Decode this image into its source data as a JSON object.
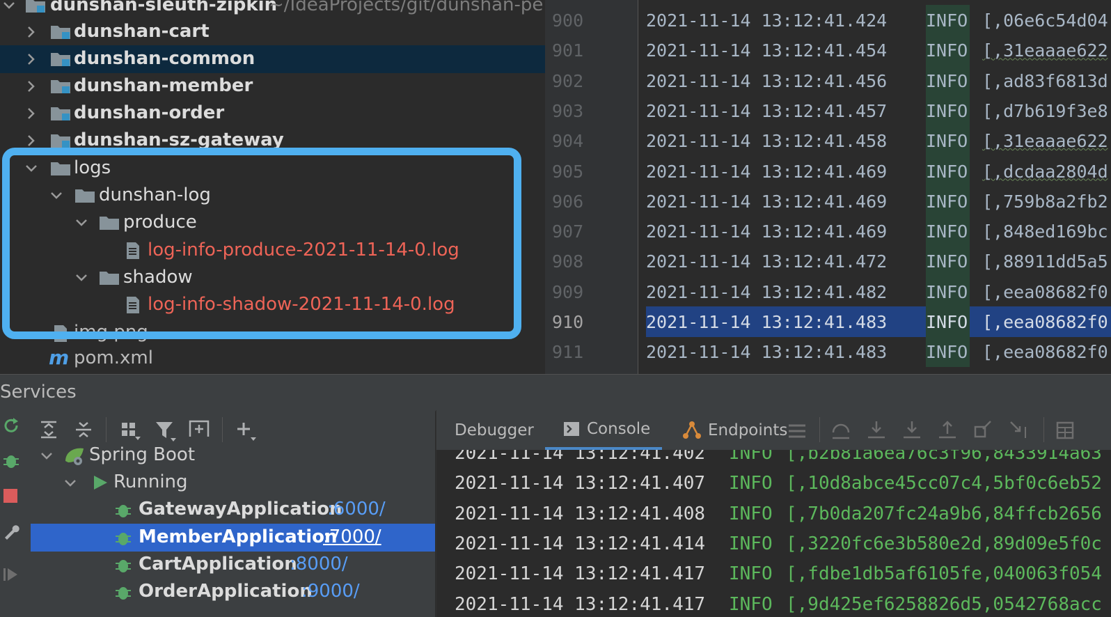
{
  "project_tree": {
    "root": {
      "name": "dunshan-sleuth-zipkin",
      "path": "~/IdeaProjects/git/dunshan-pe"
    },
    "modules": [
      "dunshan-cart",
      "dunshan-common",
      "dunshan-member",
      "dunshan-order",
      "dunshan-sz-gateway"
    ],
    "logs_folder": "logs",
    "log_subfolder": "dunshan-log",
    "produce_folder": "produce",
    "produce_file": "log-info-produce-2021-11-14-0.log",
    "shadow_folder": "shadow",
    "shadow_file": "log-info-shadow-2021-11-14-0.log",
    "img_file": "img.png",
    "pom_file": "pom.xml"
  },
  "editor": {
    "lines": [
      {
        "num": "900",
        "ts": "2021-11-14 13:12:41.424",
        "level": "INFO",
        "ctx": "[,06e6c54d04"
      },
      {
        "num": "901",
        "ts": "2021-11-14 13:12:41.454",
        "level": "INFO",
        "ctx": "[,31eaaae622"
      },
      {
        "num": "902",
        "ts": "2021-11-14 13:12:41.456",
        "level": "INFO",
        "ctx": "[,ad83f6813d"
      },
      {
        "num": "903",
        "ts": "2021-11-14 13:12:41.457",
        "level": "INFO",
        "ctx": "[,d7b619f3e8"
      },
      {
        "num": "904",
        "ts": "2021-11-14 13:12:41.458",
        "level": "INFO",
        "ctx": "[,31eaaae622"
      },
      {
        "num": "905",
        "ts": "2021-11-14 13:12:41.469",
        "level": "INFO",
        "ctx": "[,dcdaa2804d"
      },
      {
        "num": "906",
        "ts": "2021-11-14 13:12:41.469",
        "level": "INFO",
        "ctx": "[,759b8a2fb2"
      },
      {
        "num": "907",
        "ts": "2021-11-14 13:12:41.469",
        "level": "INFO",
        "ctx": "[,848ed169bc"
      },
      {
        "num": "908",
        "ts": "2021-11-14 13:12:41.472",
        "level": "INFO",
        "ctx": "[,88911dd5a5"
      },
      {
        "num": "909",
        "ts": "2021-11-14 13:12:41.482",
        "level": "INFO",
        "ctx": "[,eea08682f0"
      },
      {
        "num": "910",
        "ts": "2021-11-14 13:12:41.483",
        "level": "INFO",
        "ctx": "[,eea08682f0"
      },
      {
        "num": "911",
        "ts": "2021-11-14 13:12:41.483",
        "level": "INFO",
        "ctx": "[,eea08682f0"
      }
    ]
  },
  "services": {
    "title": "Services",
    "tree": {
      "spring_boot": "Spring Boot",
      "running": "Running",
      "apps": [
        {
          "name": "GatewayApplication",
          "port": ":6000/"
        },
        {
          "name": "MemberApplication",
          "port": ":7000/"
        },
        {
          "name": "CartApplication",
          "port": ":8000/"
        },
        {
          "name": "OrderApplication",
          "port": ":9000/"
        }
      ]
    },
    "tabs": {
      "debugger": "Debugger",
      "console": "Console",
      "endpoints": "Endpoints"
    },
    "console_lines": [
      {
        "ts": "2021-11-14 13:12:41.402",
        "level": "INFO",
        "ctx": "[,b2b81a6ea76c3f96,8433914a63"
      },
      {
        "ts": "2021-11-14 13:12:41.407",
        "level": "INFO",
        "ctx": "[,10d8abce45cc07c4,5bf0c6eb52"
      },
      {
        "ts": "2021-11-14 13:12:41.408",
        "level": "INFO",
        "ctx": "[,7b0da207fc24a9b6,84ffcb2656"
      },
      {
        "ts": "2021-11-14 13:12:41.414",
        "level": "INFO",
        "ctx": "[,3220fc6e3b580e2d,89d09e5f0c"
      },
      {
        "ts": "2021-11-14 13:12:41.417",
        "level": "INFO",
        "ctx": "[,fdbe1db5af6105fe,040063f054"
      },
      {
        "ts": "2021-11-14 13:12:41.417",
        "level": "INFO",
        "ctx": "[,9d425ef6258826d5,0542768acc"
      }
    ]
  },
  "colors": {
    "selection": "#2f65ca",
    "highlight_box": "#4fb0f0",
    "log_green": "#5cb85c",
    "file_red": "#ee6457"
  }
}
